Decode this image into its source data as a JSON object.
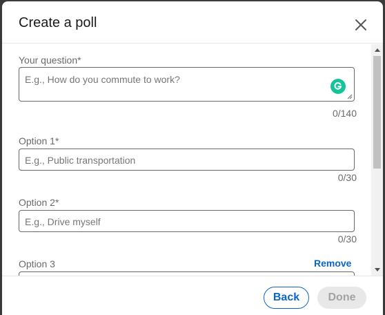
{
  "dialog": {
    "title": "Create a poll",
    "close_icon": "close-icon"
  },
  "question": {
    "label": "Your question",
    "required_mark": "*",
    "placeholder": "E.g., How do you commute to work?",
    "counter": "0/140",
    "assistant_icon": "grammarly-icon",
    "assistant_color": "#15c39a"
  },
  "options": [
    {
      "label": "Option 1",
      "required_mark": "*",
      "placeholder": "E.g., Public transportation",
      "counter": "0/30"
    },
    {
      "label": "Option 2",
      "required_mark": "*",
      "placeholder": "E.g., Drive myself",
      "counter": "0/30"
    },
    {
      "label": "Option 3",
      "remove_label": "Remove"
    }
  ],
  "footer": {
    "back_label": "Back",
    "done_label": "Done"
  },
  "colors": {
    "accent": "#0a66c2",
    "disabled_bg": "#e8e8e8"
  }
}
